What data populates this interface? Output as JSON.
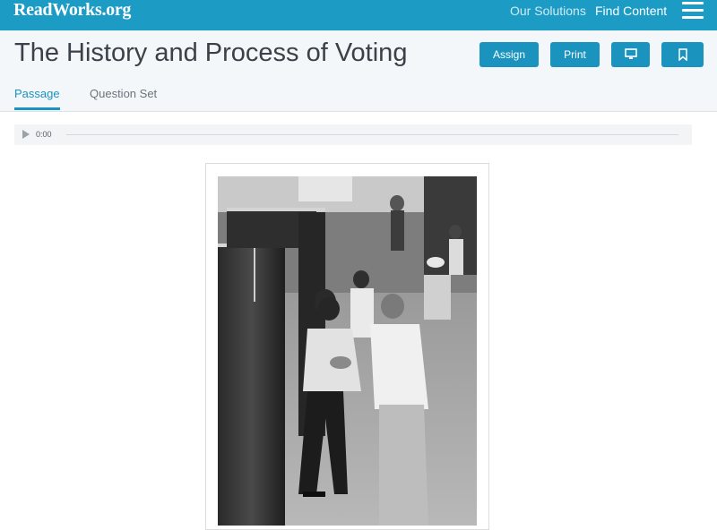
{
  "brand": {
    "logo_text": "ReadWorks",
    "logo_suffix": ".org"
  },
  "topnav": {
    "our_solutions": "Our Solutions",
    "find_content": "Find Content"
  },
  "page": {
    "title": "The History and Process of Voting"
  },
  "actions": {
    "assign": "Assign",
    "print": "Print"
  },
  "tabs": [
    {
      "label": "Passage",
      "active": true
    },
    {
      "label": "Question Set",
      "active": false
    }
  ],
  "audio": {
    "time": "0:00"
  },
  "colors": {
    "brand": "#1c9cc4",
    "button": "#1a93bf",
    "title_text": "#3a4148"
  }
}
